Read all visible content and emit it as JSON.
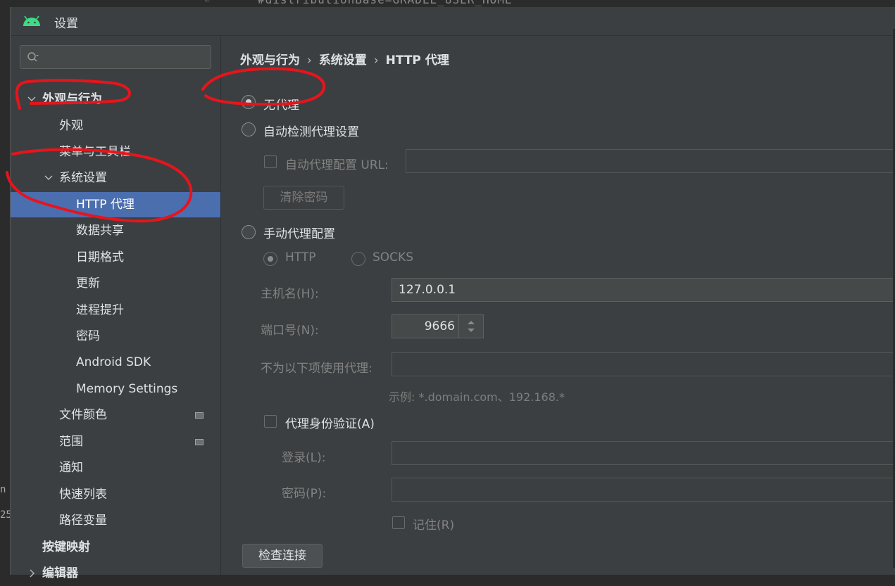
{
  "background": {
    "code_text": "#distributionBase=GRADLE_USER_HOME",
    "line_number": "2",
    "fragment_1": "n",
    "fragment_2": "25"
  },
  "window": {
    "title": "设置"
  },
  "search": {
    "placeholder": ""
  },
  "sidebar": {
    "items": [
      {
        "label": "外观与行为"
      },
      {
        "label": "外观"
      },
      {
        "label": "菜单与工具栏"
      },
      {
        "label": "系统设置"
      },
      {
        "label": "HTTP 代理"
      },
      {
        "label": "数据共享"
      },
      {
        "label": "日期格式"
      },
      {
        "label": "更新"
      },
      {
        "label": "进程提升"
      },
      {
        "label": "密码"
      },
      {
        "label": "Android SDK"
      },
      {
        "label": "Memory Settings"
      },
      {
        "label": "文件颜色"
      },
      {
        "label": "范围"
      },
      {
        "label": "通知"
      },
      {
        "label": "快速列表"
      },
      {
        "label": "路径变量"
      },
      {
        "label": "按键映射"
      },
      {
        "label": "编辑器"
      }
    ]
  },
  "breadcrumb": {
    "part1": "外观与行为",
    "part2": "系统设置",
    "part3": "HTTP 代理",
    "separator": "›"
  },
  "proxy": {
    "no_proxy": "无代理",
    "auto_detect": "自动检测代理设置",
    "auto_config_url_label": "自动代理配置 URL:",
    "auto_config_url_value": "",
    "clear_password": "清除密码",
    "manual": "手动代理配置",
    "type_http": "HTTP",
    "type_socks": "SOCKS",
    "host_label": "主机名(H):",
    "host_value": "127.0.0.1",
    "port_label": "端口号(N):",
    "port_value": "9666",
    "no_proxy_for_label": "不为以下项使用代理:",
    "no_proxy_for_value": "",
    "example_hint": "示例: *.domain.com、192.168.*",
    "auth_label": "代理身份验证(A)",
    "login_label": "登录(L):",
    "login_value": "",
    "password_label": "密码(P):",
    "password_value": "",
    "remember_label": "记住(R)",
    "check_connection": "检查连接"
  },
  "colors": {
    "selection": "#4b6eaf",
    "annotation_red": "#e8141c",
    "android_green": "#3ddc84"
  }
}
